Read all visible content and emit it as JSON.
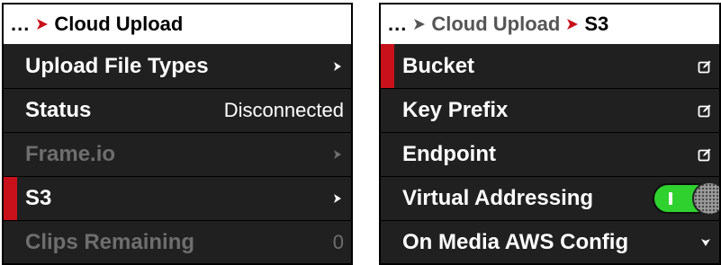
{
  "left_panel": {
    "breadcrumb": {
      "ellipsis": "...",
      "current": "Cloud Upload"
    },
    "rows": [
      {
        "label": "Upload File Types",
        "value": "",
        "selected": false,
        "disabled": false
      },
      {
        "label": "Status",
        "value": "Disconnected",
        "selected": false,
        "disabled": false
      },
      {
        "label": "Frame.io",
        "value": "",
        "selected": false,
        "disabled": true
      },
      {
        "label": "S3",
        "value": "",
        "selected": true,
        "disabled": false
      },
      {
        "label": "Clips Remaining",
        "value": "0",
        "selected": false,
        "disabled": true
      }
    ]
  },
  "right_panel": {
    "breadcrumb": {
      "ellipsis": "...",
      "parent": "Cloud Upload",
      "current": "S3"
    },
    "rows": [
      {
        "label": "Bucket",
        "icon": "edit-icon",
        "selected": true
      },
      {
        "label": "Key Prefix",
        "icon": "edit-icon",
        "selected": false
      },
      {
        "label": "Endpoint",
        "icon": "edit-icon",
        "selected": false
      },
      {
        "label": "Virtual Addressing",
        "icon": "toggle-switch",
        "toggle_on": true,
        "selected": false
      },
      {
        "label": "On Media AWS Config",
        "icon": "chevron-down-icon",
        "selected": false
      }
    ]
  },
  "colors": {
    "accent_red": "#c8111b",
    "row_background": "#202020",
    "toggle_on": "#2fd12f",
    "disabled_text": "#6e6e6e"
  }
}
